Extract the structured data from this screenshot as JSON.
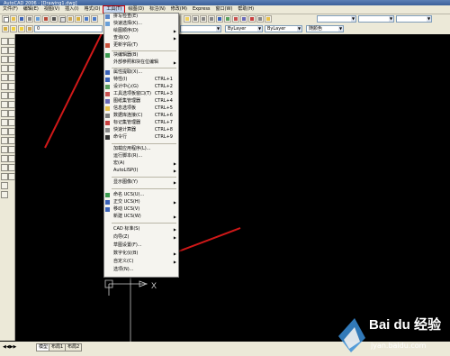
{
  "title_bar": "AutoCAD 2006 - [Drawing1.dwg]",
  "menubar": [
    {
      "label": "文件(F)"
    },
    {
      "label": "编辑(E)"
    },
    {
      "label": "视图(V)"
    },
    {
      "label": "插入(I)"
    },
    {
      "label": "格式(O)"
    },
    {
      "label": "工具(T)",
      "active": true
    },
    {
      "label": "绘图(D)"
    },
    {
      "label": "标注(N)"
    },
    {
      "label": "修改(M)"
    },
    {
      "label": "Express"
    },
    {
      "label": "窗口(W)"
    },
    {
      "label": "帮助(H)"
    }
  ],
  "toolbar": {
    "layer_value": "0",
    "linetype_1": "ByLayer",
    "linetype_2": "ByLayer",
    "color": "随颜色"
  },
  "menu_tools": [
    {
      "label": "拼写检查(E)",
      "icon": "spell-icon"
    },
    {
      "label": "快速选择(K)...",
      "icon": "qselect-icon"
    },
    {
      "label": "绘图顺序(D)",
      "submenu": true
    },
    {
      "label": "查询(Q)",
      "submenu": true
    },
    {
      "label": "更新字段(T)",
      "icon": "update-field-icon"
    },
    {
      "sep": true
    },
    {
      "label": "块编辑器(B)",
      "icon": "block-editor-icon"
    },
    {
      "label": "外部参照和块在位编辑",
      "submenu": true
    },
    {
      "sep": true
    },
    {
      "label": "属性提取(X)...",
      "icon": "attribute-icon"
    },
    {
      "label": "特性(I)",
      "shortcut": "CTRL+1",
      "icon": "properties-icon"
    },
    {
      "label": "设计中心(G)",
      "shortcut": "CTRL+2",
      "icon": "design-center-icon"
    },
    {
      "label": "工具选项板窗口(T)",
      "shortcut": "CTRL+3",
      "icon": "tool-palette-icon"
    },
    {
      "label": "图纸集管理器",
      "shortcut": "CTRL+4",
      "icon": "sheet-set-icon"
    },
    {
      "label": "信息选项板",
      "shortcut": "CTRL+5",
      "icon": "info-palette-icon"
    },
    {
      "label": "数据库连接(C)",
      "shortcut": "CTRL+6",
      "icon": "db-connect-icon"
    },
    {
      "label": "标记集管理器",
      "shortcut": "CTRL+7",
      "icon": "markup-set-icon"
    },
    {
      "label": "快速计算器",
      "shortcut": "CTRL+8",
      "icon": "calculator-icon"
    },
    {
      "label": "命令行",
      "shortcut": "CTRL+9",
      "icon": "command-line-icon"
    },
    {
      "sep": true
    },
    {
      "label": "加载应用程序(L)..."
    },
    {
      "label": "运行脚本(R)..."
    },
    {
      "label": "宏(A)",
      "submenu": true
    },
    {
      "label": "AutoLISP(I)",
      "submenu": true
    },
    {
      "sep": true
    },
    {
      "label": "显示图像(Y)",
      "submenu": true
    },
    {
      "sep": true
    },
    {
      "label": "命名 UCS(U)...",
      "icon": "ucs-named-icon"
    },
    {
      "label": "正交 UCS(H)",
      "submenu": true,
      "icon": "ucs-ortho-icon"
    },
    {
      "label": "移动 UCS(V)",
      "icon": "ucs-move-icon"
    },
    {
      "label": "新建 UCS(W)",
      "submenu": true
    },
    {
      "sep": true
    },
    {
      "label": "CAD 标准(S)",
      "submenu": true
    },
    {
      "label": "向导(Z)",
      "submenu": true
    },
    {
      "label": "草图设置(F)..."
    },
    {
      "label": "数字化仪(B)",
      "submenu": true
    },
    {
      "label": "自定义(C)",
      "submenu": true
    },
    {
      "label": "选项(N)..."
    }
  ],
  "layout_tabs": [
    "模型",
    "布局1",
    "布局2"
  ],
  "ucs_x_label": "X",
  "watermark": "Bai du 经验",
  "watermark_site": "jyan.baidu.com",
  "accent_red": "#d01818"
}
